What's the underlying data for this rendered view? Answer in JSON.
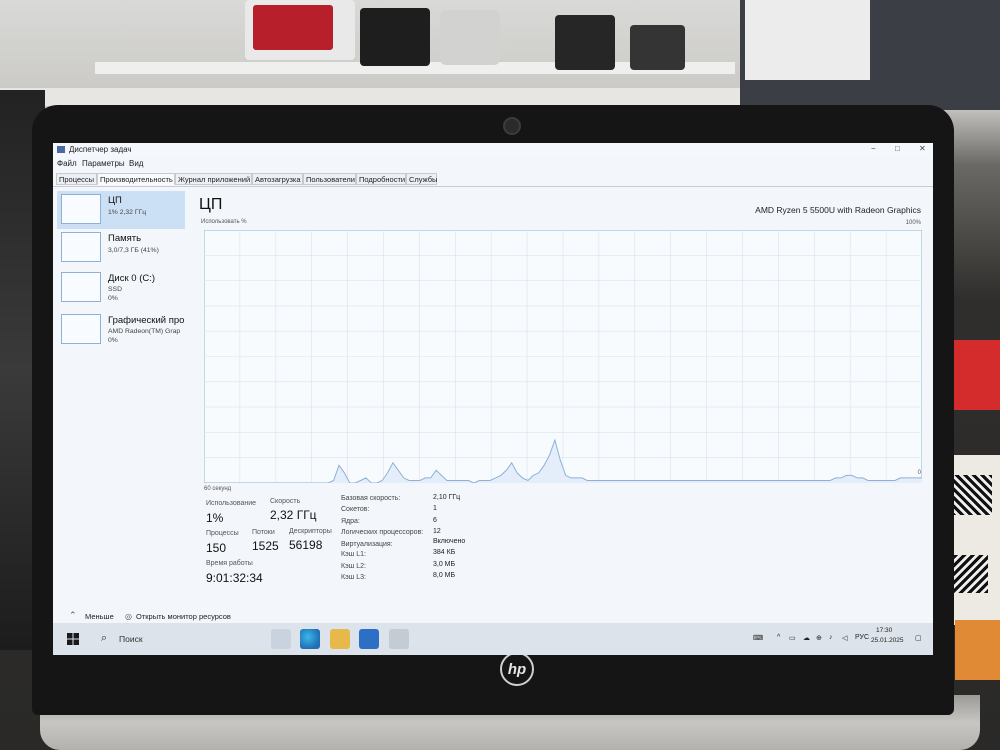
{
  "window": {
    "title": "Диспетчер задач",
    "minimize": "−",
    "maximize": "□",
    "close": "✕"
  },
  "menu": [
    "Файл",
    "Параметры",
    "Вид"
  ],
  "tabs": [
    "Процессы",
    "Производительность",
    "Журнал приложений",
    "Автозагрузка",
    "Пользователи",
    "Подробности",
    "Службы"
  ],
  "active_tab": "Производительность",
  "sidebar": {
    "items": [
      {
        "title": "ЦП",
        "line1": "1% 2,32 ГГц",
        "line2": ""
      },
      {
        "title": "Память",
        "line1": "3,0/7,3 ГБ (41%)",
        "line2": ""
      },
      {
        "title": "Диск 0 (C:)",
        "line1": "SSD",
        "line2": "0%"
      },
      {
        "title": "Графический про",
        "line1": "AMD Radeon(TM) Grap",
        "line2": "0%"
      }
    ]
  },
  "cpu": {
    "heading": "ЦП",
    "model": "AMD Ryzen 5 5500U with Radeon Graphics",
    "usage_axis_label": "Использовать %",
    "pct_max": "100%",
    "pct_min": "0",
    "time_axis_label": "60 секунд",
    "graph_values": [
      0,
      0,
      0,
      0,
      0,
      0,
      0,
      0,
      0,
      0,
      0,
      0,
      0,
      0,
      0,
      0,
      0,
      0,
      0,
      0,
      0,
      0,
      0,
      0,
      1,
      7,
      4,
      0,
      0,
      1,
      2,
      0,
      0,
      1,
      4,
      8,
      5,
      2,
      1,
      1,
      1,
      2,
      2,
      5,
      3,
      1,
      1,
      1,
      1,
      1,
      0,
      1,
      1,
      1,
      2,
      3,
      5,
      8,
      4,
      2,
      1,
      3,
      4,
      7,
      11,
      17,
      9,
      3,
      2,
      2,
      2,
      1,
      1,
      1,
      1,
      1,
      1,
      1,
      1,
      1,
      1,
      1,
      1,
      1,
      1,
      1,
      1,
      1,
      1,
      1,
      1,
      1,
      1,
      1,
      1,
      1,
      1,
      1,
      1,
      1,
      1,
      1,
      1,
      1,
      1,
      1,
      1,
      1,
      1,
      1,
      1,
      1,
      1,
      1,
      1,
      1,
      1,
      2,
      2,
      3,
      3,
      2,
      2,
      1,
      1,
      1,
      1,
      1,
      1,
      2,
      2,
      2,
      2,
      2
    ]
  },
  "stats": {
    "usage_label": "Использование",
    "usage_value": "1%",
    "speed_label": "Скорость",
    "speed_value": "2,32 ГГц",
    "processes_label": "Процессы",
    "processes_value": "150",
    "threads_label": "Потоки",
    "threads_value": "1525",
    "handles_label": "Дескрипторы",
    "handles_value": "56198",
    "uptime_label": "Время работы",
    "uptime_value": "9:01:32:34"
  },
  "specs": [
    {
      "label": "Базовая скорость:",
      "value": "2,10 ГГц"
    },
    {
      "label": "Сокетов:",
      "value": "1"
    },
    {
      "label": "Ядра:",
      "value": "6"
    },
    {
      "label": "Логических процессоров:",
      "value": "12"
    },
    {
      "label": "Виртуализация:",
      "value": "Включено"
    },
    {
      "label": "Кэш L1:",
      "value": "384 КБ"
    },
    {
      "label": "Кэш L2:",
      "value": "3,0 МБ"
    },
    {
      "label": "Кэш L3:",
      "value": "8,0 МБ"
    }
  ],
  "footer": {
    "less": "Меньше",
    "resource_monitor": "Открыть монитор ресурсов"
  },
  "taskbar": {
    "search": "Поиск",
    "language": "РУС",
    "time": "17:30",
    "date": "25.01.2025"
  },
  "hp_logo": "hp",
  "colors": {
    "graph_line": "#8fb0d4",
    "graph_fill": "#e3eefa",
    "graph_grid": "#d7e3f0",
    "selection": "#cbe0f5"
  }
}
